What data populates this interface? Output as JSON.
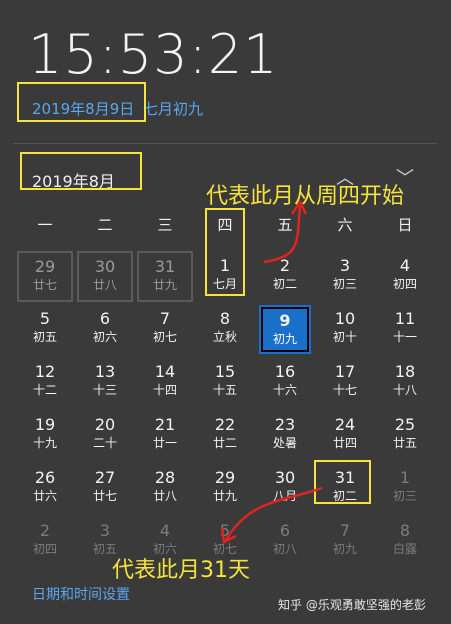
{
  "clock": {
    "time": "15:53:21"
  },
  "date": {
    "solar": "2019年8月9日",
    "lunar": "七月初九"
  },
  "calendar": {
    "month_title": "2019年8月",
    "nav_up": "︿",
    "nav_down": "﹀",
    "weekdays": [
      "一",
      "二",
      "三",
      "四",
      "五",
      "六",
      "日"
    ],
    "rows": [
      [
        {
          "d": "29",
          "l": "廿七",
          "s": "prev"
        },
        {
          "d": "30",
          "l": "廿八",
          "s": "prev"
        },
        {
          "d": "31",
          "l": "廿九",
          "s": "prev"
        },
        {
          "d": "1",
          "l": "七月",
          "s": ""
        },
        {
          "d": "2",
          "l": "初二",
          "s": ""
        },
        {
          "d": "3",
          "l": "初三",
          "s": ""
        },
        {
          "d": "4",
          "l": "初四",
          "s": ""
        }
      ],
      [
        {
          "d": "5",
          "l": "初五",
          "s": ""
        },
        {
          "d": "6",
          "l": "初六",
          "s": ""
        },
        {
          "d": "7",
          "l": "初七",
          "s": ""
        },
        {
          "d": "8",
          "l": "立秋",
          "s": ""
        },
        {
          "d": "9",
          "l": "初九",
          "s": "today"
        },
        {
          "d": "10",
          "l": "初十",
          "s": ""
        },
        {
          "d": "11",
          "l": "十一",
          "s": ""
        }
      ],
      [
        {
          "d": "12",
          "l": "十二",
          "s": ""
        },
        {
          "d": "13",
          "l": "十三",
          "s": ""
        },
        {
          "d": "14",
          "l": "十四",
          "s": ""
        },
        {
          "d": "15",
          "l": "十五",
          "s": ""
        },
        {
          "d": "16",
          "l": "十六",
          "s": ""
        },
        {
          "d": "17",
          "l": "十七",
          "s": ""
        },
        {
          "d": "18",
          "l": "十八",
          "s": ""
        }
      ],
      [
        {
          "d": "19",
          "l": "十九",
          "s": ""
        },
        {
          "d": "20",
          "l": "二十",
          "s": ""
        },
        {
          "d": "21",
          "l": "廿一",
          "s": ""
        },
        {
          "d": "22",
          "l": "廿二",
          "s": ""
        },
        {
          "d": "23",
          "l": "处暑",
          "s": ""
        },
        {
          "d": "24",
          "l": "廿四",
          "s": ""
        },
        {
          "d": "25",
          "l": "廿五",
          "s": ""
        }
      ],
      [
        {
          "d": "26",
          "l": "廿六",
          "s": ""
        },
        {
          "d": "27",
          "l": "廿七",
          "s": ""
        },
        {
          "d": "28",
          "l": "廿八",
          "s": ""
        },
        {
          "d": "29",
          "l": "廿九",
          "s": ""
        },
        {
          "d": "30",
          "l": "八月",
          "s": ""
        },
        {
          "d": "31",
          "l": "初二",
          "s": ""
        },
        {
          "d": "1",
          "l": "初三",
          "s": "next"
        }
      ],
      [
        {
          "d": "2",
          "l": "初四",
          "s": "next"
        },
        {
          "d": "3",
          "l": "初五",
          "s": "next"
        },
        {
          "d": "4",
          "l": "初六",
          "s": "next"
        },
        {
          "d": "5",
          "l": "初七",
          "s": "next"
        },
        {
          "d": "6",
          "l": "初八",
          "s": "next"
        },
        {
          "d": "7",
          "l": "初九",
          "s": "next"
        },
        {
          "d": "8",
          "l": "白露",
          "s": "next"
        }
      ]
    ]
  },
  "annotations": {
    "start": "代表此月从周四开始",
    "days": "代表此月31天"
  },
  "settings_link": "日期和时间设置",
  "watermark": "知乎 @乐观勇敢坚强的老彭",
  "colors": {
    "background": "#3a3a3a",
    "accent": "#1a6fc9",
    "link": "#5aa6f0",
    "annotation": "#f6e33b",
    "arrow": "#e0241f"
  }
}
